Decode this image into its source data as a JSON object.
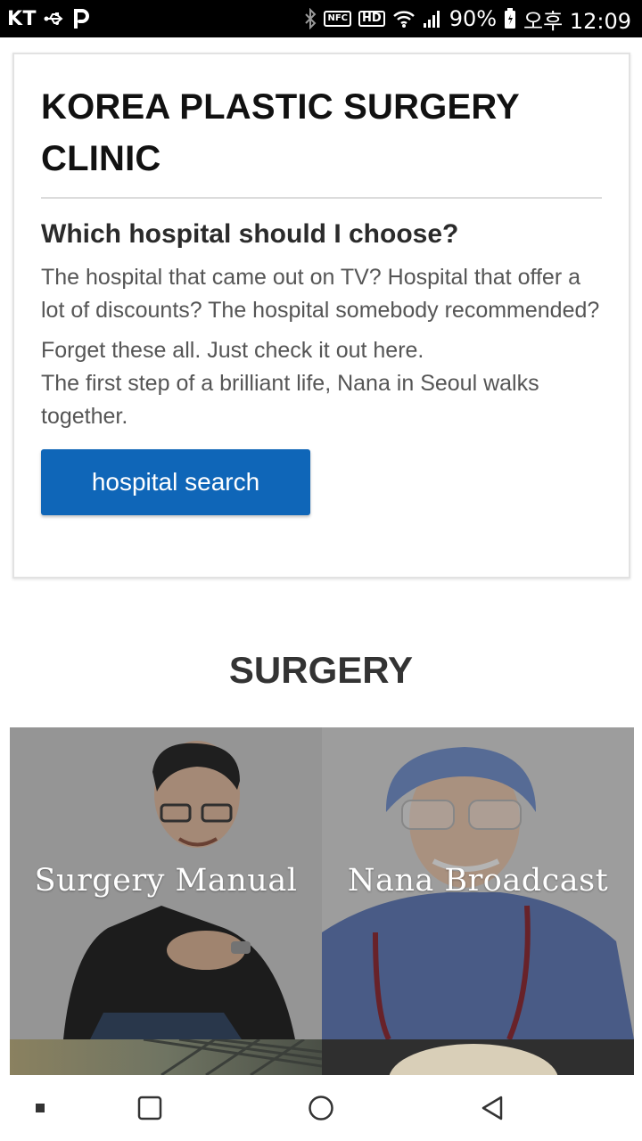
{
  "status_bar": {
    "carrier": "KT",
    "battery": "90%",
    "time": "오후 12:09",
    "nfc_label": "NFC",
    "hd_label": "HD",
    "icons": [
      "usb-icon",
      "parking-p-icon",
      "bluetooth-icon",
      "nfc-icon",
      "hd-icon",
      "wifi-icon",
      "signal-icon",
      "battery-icon"
    ]
  },
  "card": {
    "title": "KOREA PLASTIC SURGERY CLINIC",
    "subtitle": "Which hospital should I choose?",
    "paragraph1": "The hospital that came out on TV? Hospital that offer a lot of discounts? The hospital somebody recommended?",
    "paragraph2_line1": "Forget these all. Just check it out here.",
    "paragraph2_line2": "The first step of a brilliant life, Nana in Seoul walks together.",
    "button_label": "hospital search"
  },
  "section": {
    "title": "SURGERY"
  },
  "tiles": [
    {
      "label": "Surgery Manual"
    },
    {
      "label": "Nana Broadcast"
    },
    {
      "label": ""
    },
    {
      "label": ""
    }
  ],
  "nav_bar": {
    "icons": [
      "recents-dot-icon",
      "overview-square-icon",
      "home-circle-icon",
      "back-triangle-icon"
    ]
  },
  "colors": {
    "button": "#0f66b8",
    "status_bar": "#000000",
    "heading": "#111111",
    "body_text": "#555555"
  }
}
